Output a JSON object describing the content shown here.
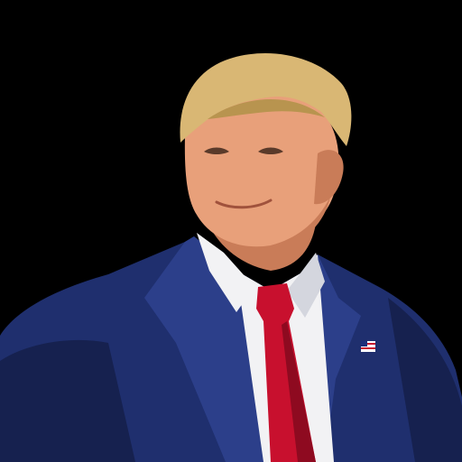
{
  "scene": {
    "description_type": "cutout portrait photo on black background",
    "background": "#000000"
  },
  "colors": {
    "suit": "#1f2f6e",
    "suit_shadow": "#16214f",
    "suit_highlight": "#2c3f8a",
    "shirt": "#f2f2f4",
    "shirt_shadow": "#d4d6de",
    "tie": "#c8102e",
    "tie_shadow": "#8e0a20",
    "skin": "#e8a07a",
    "skin_shadow": "#c97c58",
    "hair": "#d9b774",
    "hair_shadow": "#b8944f",
    "pin_white": "#ffffff",
    "pin_red": "#c8102e",
    "pin_blue": "#1c2f7a"
  },
  "elements": {
    "figure": "person",
    "clothing": [
      "navy-suit-jacket",
      "white-dress-shirt",
      "red-necktie"
    ],
    "accessory": "flag-lapel-pin-icon"
  }
}
